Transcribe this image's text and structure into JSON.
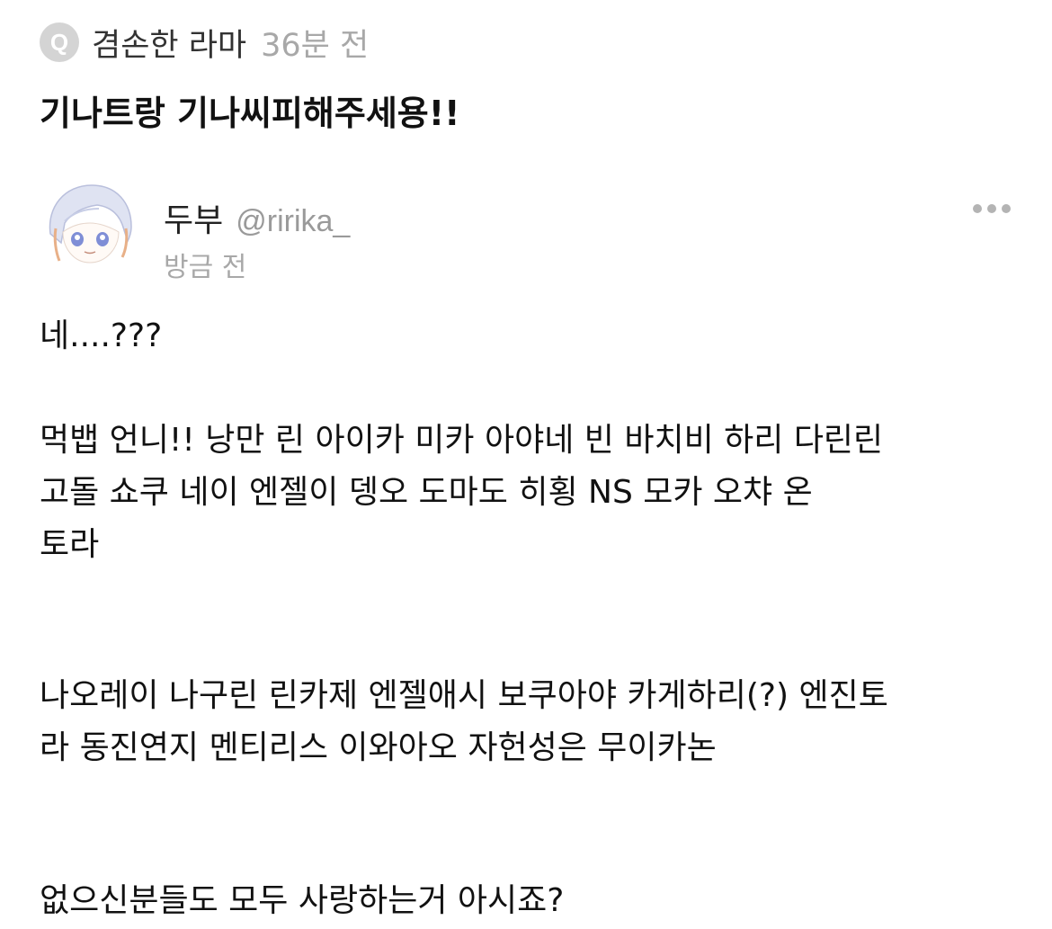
{
  "question": {
    "badge": "Q",
    "asker": "겸손한 라마",
    "time": "36분 전",
    "text": "기나트랑 기나씨피해주세용!!"
  },
  "answer": {
    "author_name": "두부",
    "author_handle": "@ririka_",
    "time": "방금 전",
    "more_icon": "ellipsis-icon",
    "lines": [
      "네....???",
      "먹뱁 언니!! 낭만 린 아이카 미카 아야네 빈 바치비 하리 다린린",
      "고돌 쇼쿠 네이 엔젤이 뎅오 도마도 히횡 NS 모카 오챠 온",
      "토라",
      "나오레이 나구린 린카제 엔젤애시 보쿠아야 카게하리(?) 엔진토",
      "라 동진연지 멘티리스 이와아오 자헌성은 무이카논",
      "없으신분들도 모두 사랑하는거 아시죠?"
    ]
  },
  "colors": {
    "badge_bg": "#d4d4d4",
    "muted_text": "#a8a8a8",
    "primary_text": "#111111"
  }
}
